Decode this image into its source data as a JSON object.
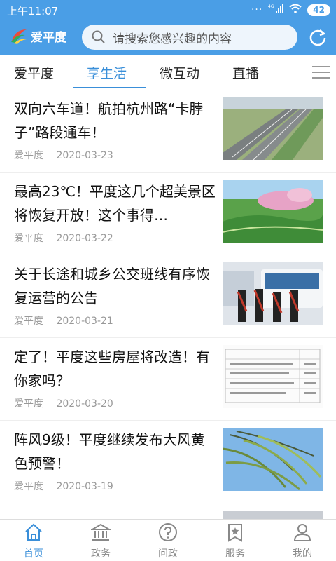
{
  "status_bar": {
    "time": "上午11:07",
    "network": "4G",
    "battery": "42"
  },
  "header": {
    "app_name": "爱平度",
    "search_placeholder": "请搜索您感兴趣的内容"
  },
  "tabs": [
    {
      "label": "爱平度",
      "active": false
    },
    {
      "label": "享生活",
      "active": true
    },
    {
      "label": "微互动",
      "active": false
    },
    {
      "label": "直播",
      "active": false
    }
  ],
  "news": [
    {
      "title": "双向六车道！航拍杭州路“卡脖子”路段通车！",
      "source": "爱平度",
      "date": "2020-03-23"
    },
    {
      "title": "最高23℃！平度这几个超美景区将恢复开放！这个事得…",
      "source": "爱平度",
      "date": "2020-03-22"
    },
    {
      "title": "关于长途和城乡公交班线有序恢复运营的公告",
      "source": "爱平度",
      "date": "2020-03-21"
    },
    {
      "title": "定了！平度这些房屋将改造！有你家吗？",
      "source": "爱平度",
      "date": "2020-03-20"
    },
    {
      "title": "阵风9级！平度继续发布大风黄色预警！",
      "source": "爱平度",
      "date": "2020-03-19"
    }
  ],
  "bottom_nav": [
    {
      "label": "首页",
      "icon": "home-icon",
      "active": true
    },
    {
      "label": "政务",
      "icon": "government-icon",
      "active": false
    },
    {
      "label": "问政",
      "icon": "question-icon",
      "active": false
    },
    {
      "label": "服务",
      "icon": "service-icon",
      "active": false
    },
    {
      "label": "我的",
      "icon": "profile-icon",
      "active": false
    }
  ],
  "colors": {
    "primary": "#4a9ee6",
    "accent": "#3a8fd9",
    "meta_text": "#999999"
  }
}
